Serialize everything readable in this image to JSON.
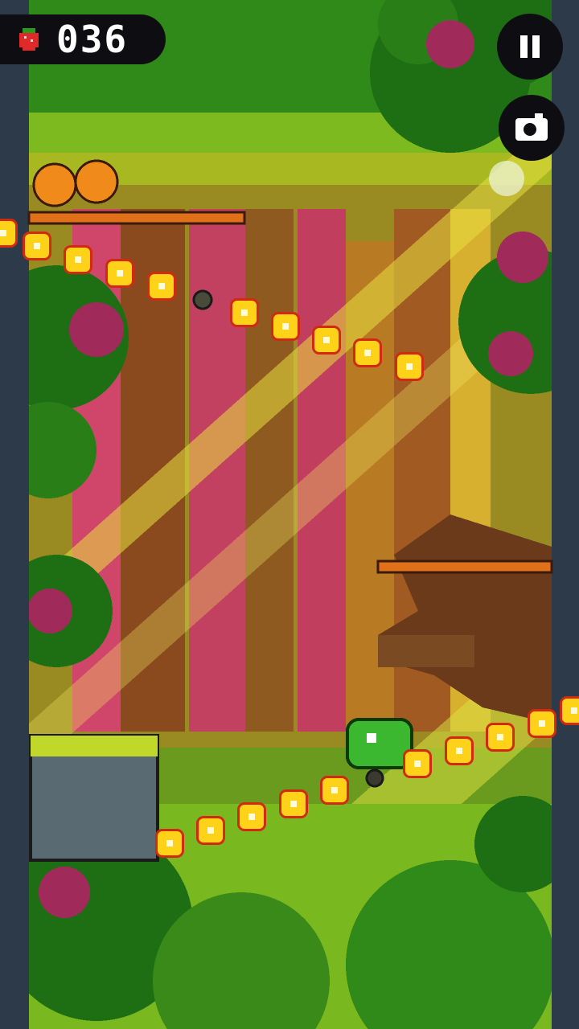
{
  "hud": {
    "score": "036",
    "score_icon": "strawberry-icon",
    "pause_icon": "pause-icon",
    "camera_icon": "camera-icon"
  },
  "colors": {
    "sky_canopy": "#5aa81c",
    "tree_trunk_brown": "#8a4a1e",
    "tree_trunk_pink": "#d0456a",
    "light_beam": "#e8e040",
    "wall": "#2c3a4a",
    "coin_fill": "#ffd21a",
    "coin_border": "#d12a10",
    "player": "#3cb830"
  }
}
